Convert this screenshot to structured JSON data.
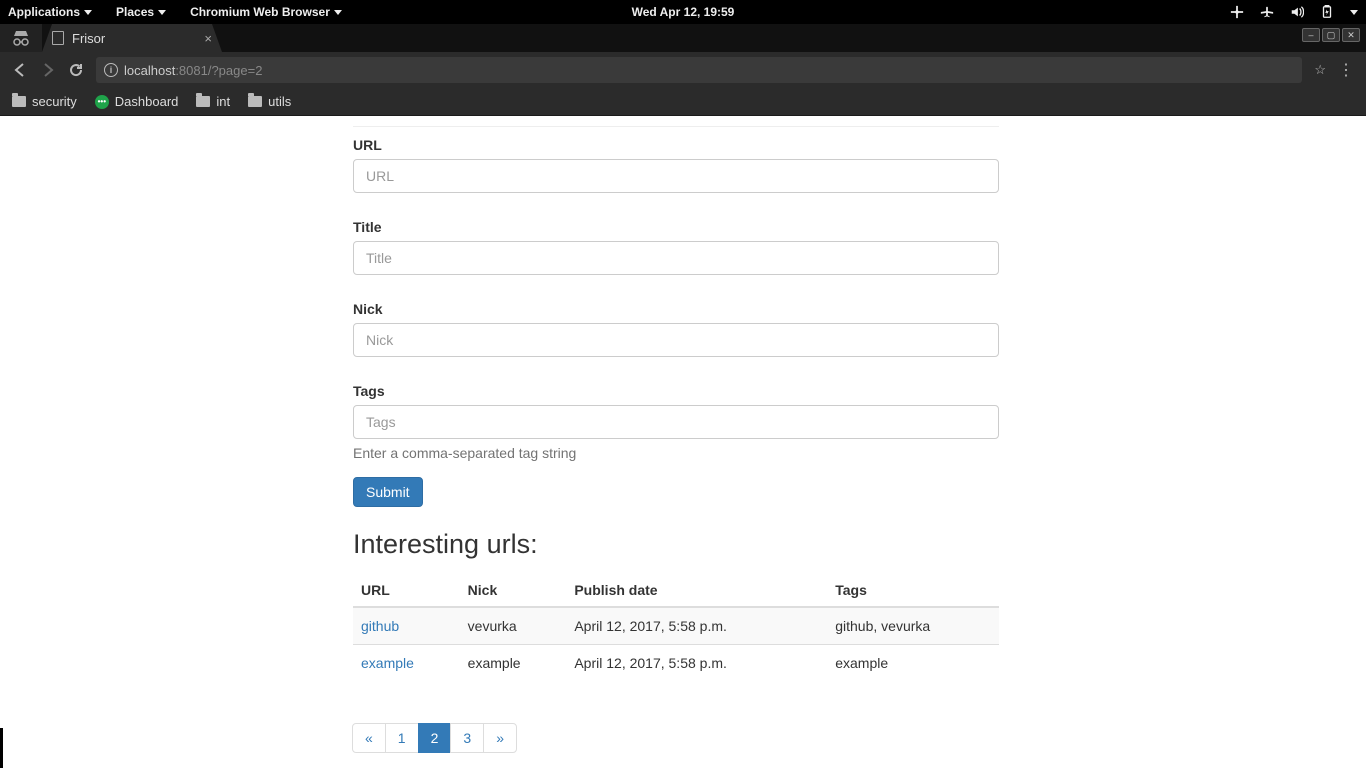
{
  "gnome": {
    "applications": "Applications",
    "places": "Places",
    "browser_menu": "Chromium Web Browser",
    "clock": "Wed Apr 12, 19:59"
  },
  "browser": {
    "tab_title": "Frisor",
    "url_host": "localhost",
    "url_port_path": ":8081/?page=2"
  },
  "bookmarks": {
    "security": "security",
    "dashboard": "Dashboard",
    "int": "int",
    "utils": "utils"
  },
  "form": {
    "url_label": "URL",
    "url_placeholder": "URL",
    "title_label": "Title",
    "title_placeholder": "Title",
    "nick_label": "Nick",
    "nick_placeholder": "Nick",
    "tags_label": "Tags",
    "tags_placeholder": "Tags",
    "tags_help": "Enter a comma-separated tag string",
    "submit": "Submit"
  },
  "table": {
    "heading": "Interesting urls:",
    "col_url": "URL",
    "col_nick": "Nick",
    "col_date": "Publish date",
    "col_tags": "Tags",
    "rows": [
      {
        "url": "github",
        "nick": "vevurka",
        "date": "April 12, 2017, 5:58 p.m.",
        "tags": "github, vevurka"
      },
      {
        "url": "example",
        "nick": "example",
        "date": "April 12, 2017, 5:58 p.m.",
        "tags": "example"
      }
    ]
  },
  "pagination": {
    "prev": "«",
    "p1": "1",
    "p2": "2",
    "p3": "3",
    "next": "»"
  }
}
